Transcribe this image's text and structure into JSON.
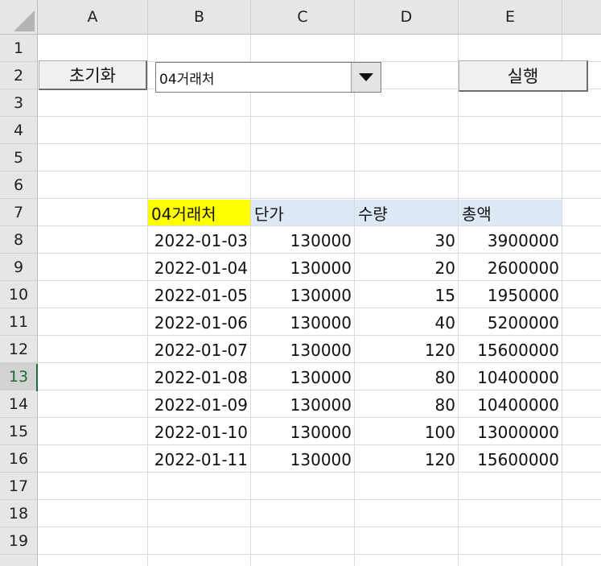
{
  "sheet": {
    "columns": [
      "A",
      "B",
      "C",
      "D",
      "E"
    ],
    "rows": [
      "1",
      "2",
      "3",
      "4",
      "5",
      "6",
      "7",
      "8",
      "9",
      "10",
      "11",
      "12",
      "13",
      "14",
      "15",
      "16",
      "17",
      "18",
      "19"
    ],
    "active_row": "13"
  },
  "controls": {
    "reset_button": "초기화",
    "dropdown_value": "04거래처",
    "run_button": "실행"
  },
  "table": {
    "headers": [
      "04거래처",
      "단가",
      "수량",
      "총액"
    ],
    "rows": [
      [
        "2022-01-03",
        "130000",
        "30",
        "3900000"
      ],
      [
        "2022-01-04",
        "130000",
        "20",
        "2600000"
      ],
      [
        "2022-01-05",
        "130000",
        "15",
        "1950000"
      ],
      [
        "2022-01-06",
        "130000",
        "40",
        "5200000"
      ],
      [
        "2022-01-07",
        "130000",
        "120",
        "15600000"
      ],
      [
        "2022-01-08",
        "130000",
        "80",
        "10400000"
      ],
      [
        "2022-01-09",
        "130000",
        "80",
        "10400000"
      ],
      [
        "2022-01-10",
        "130000",
        "100",
        "13000000"
      ],
      [
        "2022-01-11",
        "130000",
        "120",
        "15600000"
      ]
    ]
  },
  "colors": {
    "highlight": "#ffff00",
    "header_band": "#dde9f5",
    "active_row_header": "#1e6b3c"
  }
}
